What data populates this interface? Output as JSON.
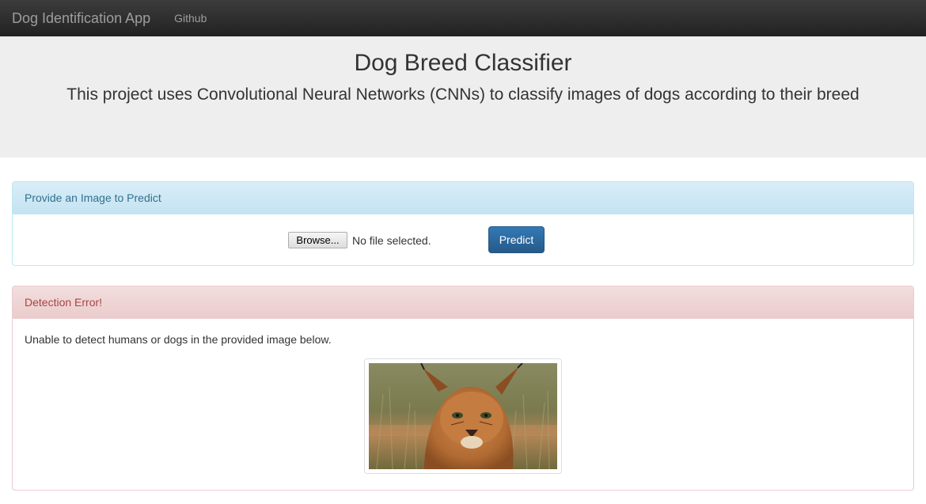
{
  "navbar": {
    "brand": "Dog Identification App",
    "links": [
      "Github"
    ]
  },
  "jumbotron": {
    "title": "Dog Breed Classifier",
    "subtitle": "This project uses Convolutional Neural Networks (CNNs) to classify images of dogs according to their breed"
  },
  "upload_panel": {
    "heading": "Provide an Image to Predict",
    "browse_label": "Browse...",
    "file_status": "No file selected.",
    "predict_label": "Predict"
  },
  "result_panel": {
    "heading": "Detection Error!",
    "message": "Unable to detect humans or dogs in the provided image below."
  },
  "colors": {
    "navbar": "#222222",
    "jumbotron": "#eeeeee",
    "info_heading": "#31708f",
    "danger_heading": "#a94442",
    "primary_button": "#337ab7"
  }
}
